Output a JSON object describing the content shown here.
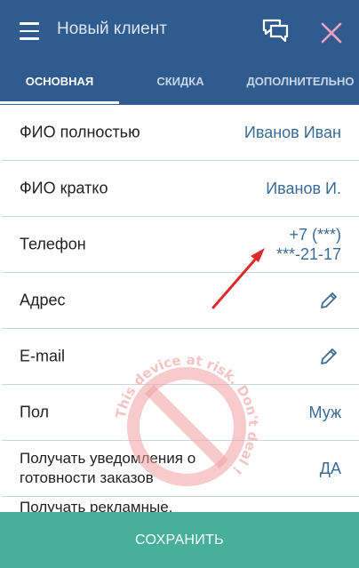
{
  "header": {
    "title": "Новый клиент",
    "icons": {
      "menu": "menu-icon",
      "chat": "chat-icon",
      "close": "close-icon"
    }
  },
  "tabs": [
    {
      "label": "ОСНОВНАЯ",
      "active": true
    },
    {
      "label": "СКИДКА",
      "active": false
    },
    {
      "label": "ДОПОЛНИТЕЛЬНО",
      "active": false
    }
  ],
  "fields": {
    "full_name": {
      "label": "ФИО полностью",
      "value": "Иванов Иван"
    },
    "short_name": {
      "label": "ФИО кратко",
      "value": "Иванов И."
    },
    "phone": {
      "label": "Телефон",
      "value_line1": "+7 (***)",
      "value_line2": "***-21-17"
    },
    "address": {
      "label": "Адрес",
      "icon": "pencil-icon"
    },
    "email": {
      "label": "E-mail",
      "icon": "pencil-icon"
    },
    "gender": {
      "label": "Пол",
      "value": "Муж"
    },
    "order_notifications": {
      "label_line1": "Получать уведомления о",
      "label_line2": "готовности заказов",
      "value": "ДА"
    },
    "ads": {
      "label": "Получать рекламные,"
    }
  },
  "footer": {
    "save_label": "СОХРАНИТЬ"
  },
  "colors": {
    "header_bg": "#2f5b8e",
    "accent_value": "#3a6b96",
    "save_bg": "#48b09a",
    "close_icon": "#f2a0c0"
  },
  "watermark": {
    "text": "This device at risk. Don't deal !"
  }
}
